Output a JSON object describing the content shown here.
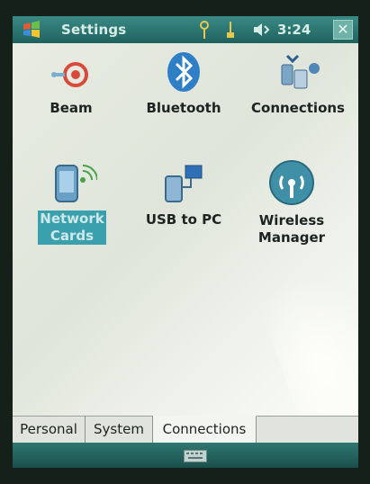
{
  "titlebar": {
    "app_title": "Settings",
    "clock": "3:24",
    "close_label": "✕"
  },
  "items": [
    {
      "label_line1": "Beam",
      "label_line2": ""
    },
    {
      "label_line1": "Bluetooth",
      "label_line2": ""
    },
    {
      "label_line1": "Connections",
      "label_line2": ""
    },
    {
      "label_line1": "Network",
      "label_line2": "Cards"
    },
    {
      "label_line1": "USB to PC",
      "label_line2": ""
    },
    {
      "label_line1": "Wireless",
      "label_line2": "Manager"
    }
  ],
  "tabs": [
    "Personal",
    "System",
    "Connections"
  ],
  "active_tab": "Connections",
  "colors": {
    "titlebar": "#1f625e",
    "selected_highlight": "#3aa0ad",
    "background": "#e6eae1"
  },
  "icons": [
    "windows-start-icon",
    "signal-icon",
    "connectivity-icon",
    "volume-icon",
    "close-icon",
    "beam-icon",
    "bluetooth-icon",
    "connections-icon",
    "network-cards-icon",
    "usb-to-pc-icon",
    "wireless-manager-icon",
    "keyboard-icon"
  ]
}
